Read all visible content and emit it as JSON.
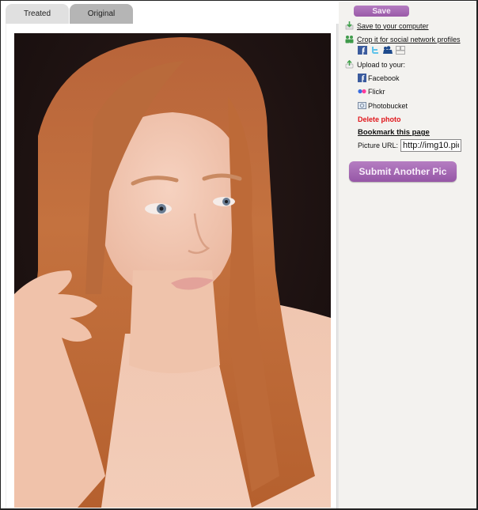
{
  "tabs": [
    {
      "label": "Treated",
      "active": false
    },
    {
      "label": "Original",
      "active": true
    }
  ],
  "photo": {
    "description": "Portrait of a red-haired woman against a dark background"
  },
  "sidebar": {
    "save_label": "Save",
    "save_to_computer": "Save to your computer",
    "crop_label": "Crop it for social network profiles",
    "crop_icons": [
      "facebook-icon",
      "twitter-icon",
      "myspace-icon",
      "friends-icon"
    ],
    "upload_label": "Upload to your:",
    "upload_targets": [
      {
        "label": "Facebook",
        "icon": "facebook-icon"
      },
      {
        "label": "Flickr",
        "icon": "flickr-icon"
      },
      {
        "label": "Photobucket",
        "icon": "photobucket-icon"
      }
    ],
    "delete_label": "Delete photo",
    "bookmark_label": "Bookmark this page",
    "picture_url_label": "Picture URL:",
    "picture_url_value": "http://img10.pic",
    "submit_label": "Submit Another Pic"
  },
  "colors": {
    "button_purple": "#a66bb5",
    "delete_red": "#e0161b",
    "sidebar_bg": "#f3f2ef",
    "tab_active": "#b5b5b5",
    "tab_inactive": "#e0e0e0"
  }
}
